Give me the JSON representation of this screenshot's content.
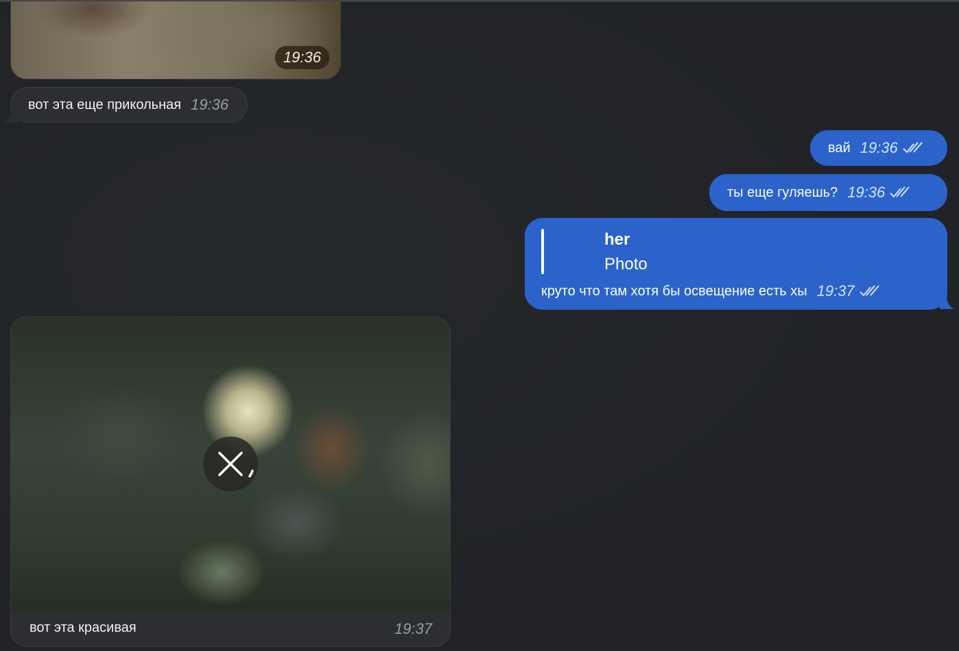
{
  "messages": {
    "photo_top": {
      "time": "19:36"
    },
    "incoming_1": {
      "text": "вот эта еще прикольная",
      "time": "19:36"
    },
    "outgoing_1": {
      "text": "вай",
      "time": "19:36",
      "status": "read"
    },
    "outgoing_2": {
      "text": "ты еще гуляешь?",
      "time": "19:36",
      "status": "read"
    },
    "outgoing_3": {
      "reply": {
        "name": "her",
        "text": "Photo"
      },
      "text": "круто что там хотя бы освещение есть хы",
      "time": "19:37",
      "status": "read"
    },
    "photo_bottom": {
      "caption": "вот эта красивая",
      "time": "19:37",
      "state": "downloading"
    }
  },
  "colors": {
    "background": "#212326",
    "incoming_bubble": "#2c2e31",
    "outgoing_bubble": "#2b63cb"
  }
}
